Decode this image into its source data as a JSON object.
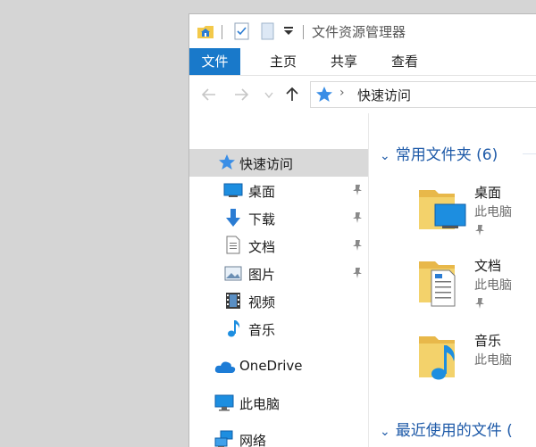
{
  "window": {
    "title": "文件资源管理器"
  },
  "ribbon": {
    "tabs": [
      {
        "label": "文件"
      },
      {
        "label": "主页"
      },
      {
        "label": "共享"
      },
      {
        "label": "查看"
      }
    ]
  },
  "address": {
    "location": "快速访问"
  },
  "nav_pane": {
    "items": [
      {
        "label": "快速访问",
        "icon": "star-icon",
        "selected": true
      },
      {
        "label": "桌面",
        "icon": "desktop-icon",
        "pinned": true
      },
      {
        "label": "下载",
        "icon": "download-icon",
        "pinned": true
      },
      {
        "label": "文档",
        "icon": "document-icon",
        "pinned": true
      },
      {
        "label": "图片",
        "icon": "picture-icon",
        "pinned": true
      },
      {
        "label": "视频",
        "icon": "video-icon"
      },
      {
        "label": "音乐",
        "icon": "music-icon"
      },
      {
        "label": "OneDrive",
        "icon": "cloud-icon"
      },
      {
        "label": "此电脑",
        "icon": "computer-icon"
      },
      {
        "label": "网络",
        "icon": "network-icon"
      }
    ]
  },
  "content": {
    "frequent_header": "常用文件夹 (6)",
    "recent_header": "最近使用的文件 (",
    "folders": [
      {
        "name": "桌面",
        "location": "此电脑",
        "pinned": true
      },
      {
        "name": "文档",
        "location": "此电脑",
        "pinned": true
      },
      {
        "name": "音乐",
        "location": "此电脑",
        "pinned": false
      }
    ]
  },
  "colors": {
    "accent": "#1979ca",
    "folder": "#f3d26b",
    "group_header": "#1e5aa8"
  }
}
